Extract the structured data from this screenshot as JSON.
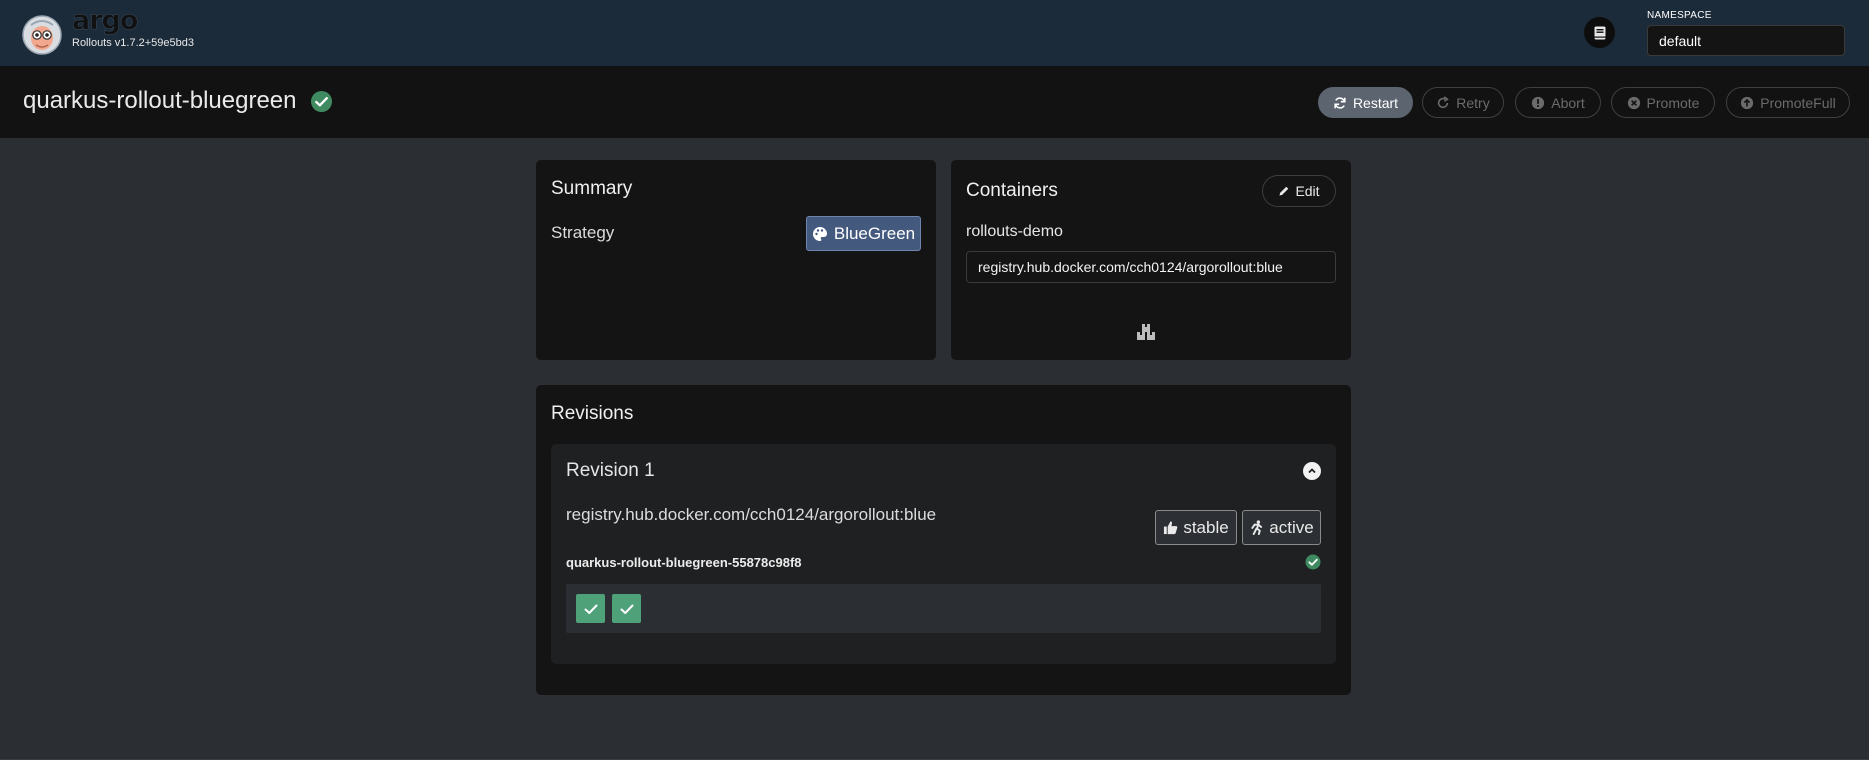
{
  "app": {
    "brand": "argo",
    "version": "Rollouts v1.7.2+59e5bd3"
  },
  "namespace": {
    "label": "NAMESPACE",
    "value": "default"
  },
  "rollout": {
    "name": "quarkus-rollout-bluegreen",
    "status": "healthy"
  },
  "actions": {
    "restart": "Restart",
    "retry": "Retry",
    "abort": "Abort",
    "promote": "Promote",
    "promote_full": "PromoteFull"
  },
  "summary": {
    "title": "Summary",
    "strategy_label": "Strategy",
    "strategy_value": "BlueGreen"
  },
  "containers": {
    "title": "Containers",
    "edit_label": "Edit",
    "items": [
      {
        "name": "rollouts-demo",
        "image": "registry.hub.docker.com/cch0124/argorollout:blue"
      }
    ]
  },
  "revisions": {
    "title": "Revisions",
    "items": [
      {
        "title": "Revision 1",
        "image": "registry.hub.docker.com/cch0124/argorollout:blue",
        "tags": [
          "stable",
          "active"
        ],
        "replicaset": "quarkus-rollout-bluegreen-55878c98f8",
        "pods": [
          "ready",
          "ready"
        ]
      }
    ]
  },
  "colors": {
    "header_bg": "#1c2b3a",
    "title_bar_bg": "#121212",
    "page_bg": "#2b2e33",
    "panel_bg": "#141414",
    "success_green": "#4fa17a",
    "strategy_badge": "#44597e"
  },
  "icons": {
    "docs": "book-icon",
    "restart": "sync-icon",
    "retry": "redo-icon",
    "abort": "exclamation-circle-icon",
    "promote": "times-circle-icon",
    "promote_full": "arrow-circle-up-icon",
    "strategy": "palette-icon",
    "edit": "pencil-icon",
    "add_container": "boxes-icon",
    "collapse": "chevron-up-icon",
    "stable": "thumbs-up-icon",
    "active": "running-icon",
    "pod": "check-icon"
  }
}
